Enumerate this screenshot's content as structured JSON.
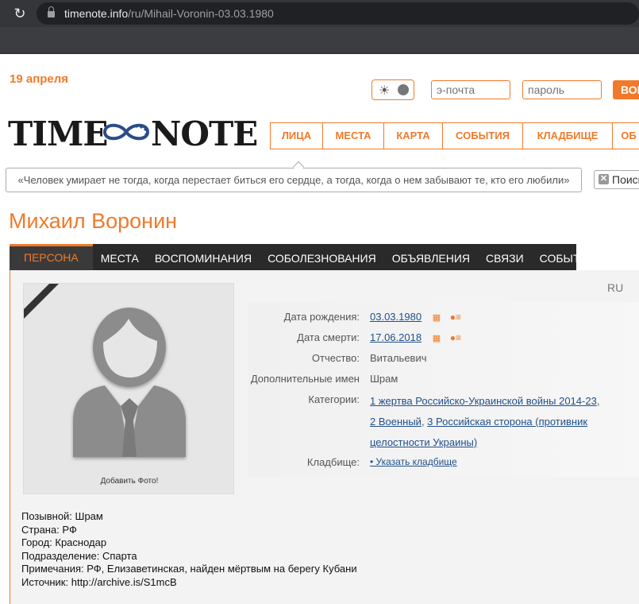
{
  "browser": {
    "url_host": "timenote.info",
    "url_path": "/ru/Mihail-Voronin-03.03.1980"
  },
  "header": {
    "date": "19 апреля",
    "email_placeholder": "э-почта",
    "password_placeholder": "пароль",
    "login_label": "ВОЙТИ"
  },
  "logo": {
    "left": "TIME",
    "right": "NOTE"
  },
  "nav": {
    "items": [
      "ЛИЦА",
      "МЕСТА",
      "КАРТА",
      "СОБЫТИЯ",
      "КЛАДБИЩЕ",
      "ОБ"
    ]
  },
  "quote": "«Человек умирает не тогда, когда перестает биться его сердце, а тогда, когда о нем забывают те, кто его любили»",
  "search_label": "Поиск",
  "person": {
    "name": "Михаил Воронин",
    "lang": "RU",
    "add_photo": "Добавить Фото!"
  },
  "tabs": [
    "ПЕРСОНА",
    "МЕСТА",
    "ВОСПОМИНАНИЯ",
    "СОБОЛЕЗНОВАНИЯ",
    "ОБЪЯВЛЕНИЯ",
    "СВЯЗИ",
    "СОБЫТИЯ"
  ],
  "info": {
    "labels": {
      "birth": "Дата рождения:",
      "death": "Дата смерти:",
      "patronymic": "Отчество:",
      "extra_names": "Дополнительные имен",
      "categories": "Категории:",
      "cemetery": "Кладбище:"
    },
    "birth": "03.03.1980",
    "death": "17.06.2018",
    "patronymic": "Витальевич",
    "extra_names": "Шрам",
    "categories": {
      "c1": "1 жертва Российско-Украинской войны 2014-23",
      "c2": "2 Военный",
      "c3a": "3 Российская сторона (противник",
      "c3b": "целостности Украины)"
    },
    "cemetery": "• Указать кладбище"
  },
  "notes": [
    "Позывной: Шрам",
    "Страна: РФ",
    "Город: Краснодар",
    "Подразделение: Спарта",
    "Примечания: РФ, Елизаветинская, найден мёртвым на берегу Кубани",
    "Источник: http://archive.is/S1mcB"
  ]
}
